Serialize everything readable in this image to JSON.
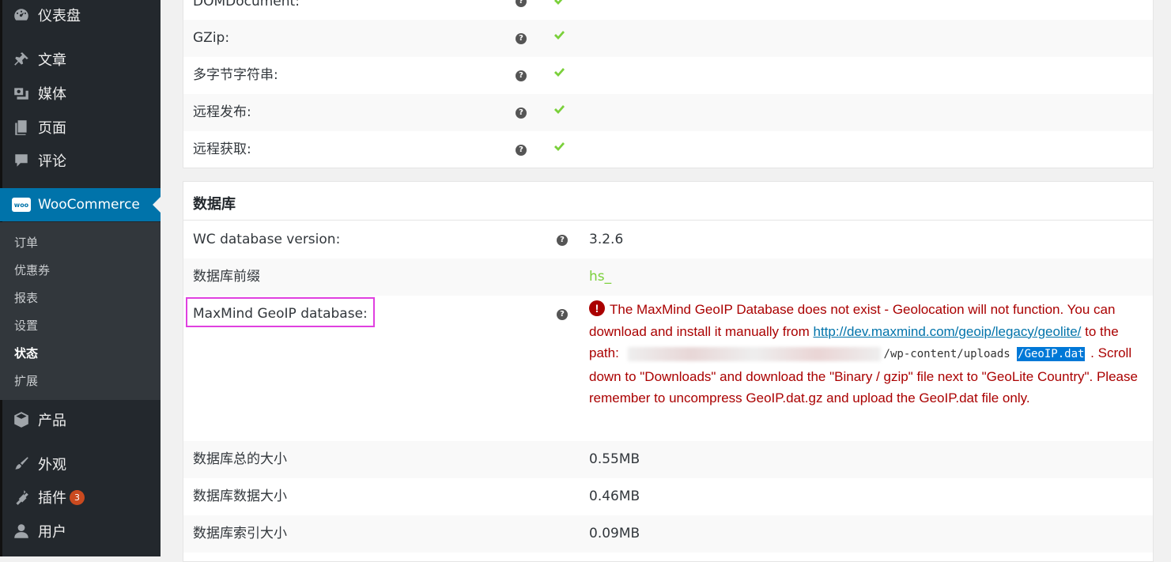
{
  "sidebar": {
    "items": [
      {
        "label": "仪表盘",
        "icon": "dashboard-icon"
      },
      {
        "label": "文章",
        "icon": "pin-icon"
      },
      {
        "label": "媒体",
        "icon": "media-icon"
      },
      {
        "label": "页面",
        "icon": "pages-icon"
      },
      {
        "label": "评论",
        "icon": "comment-icon"
      },
      {
        "label": "WooCommerce",
        "icon": "woocommerce-icon",
        "logo_text": "woo"
      },
      {
        "label": "产品",
        "icon": "product-box-icon"
      },
      {
        "label": "外观",
        "icon": "brush-icon"
      },
      {
        "label": "插件",
        "icon": "plugin-icon",
        "badge": "3"
      },
      {
        "label": "用户",
        "icon": "user-icon"
      }
    ],
    "woocommerce_submenu": [
      "订单",
      "优惠券",
      "报表",
      "设置",
      "状态",
      "扩展"
    ],
    "current_submenu": "状态"
  },
  "server_env": {
    "rows": [
      {
        "label": "DOMDocument:",
        "status": "ok"
      },
      {
        "label": "GZip:",
        "status": "ok"
      },
      {
        "label": "多字节字符串:",
        "status": "ok"
      },
      {
        "label": "远程发布:",
        "status": "ok"
      },
      {
        "label": "远程获取:",
        "status": "ok"
      }
    ]
  },
  "database": {
    "title": "数据库",
    "rows": [
      {
        "label": "WC database version:",
        "value": "3.2.6"
      },
      {
        "label": "数据库前缀",
        "value": "hs_"
      },
      {
        "label": "MaxMind GeoIP database:",
        "value": ""
      },
      {
        "label": "数据库总的大小",
        "value": "0.55MB"
      },
      {
        "label": "数据库数据大小",
        "value": "0.46MB"
      },
      {
        "label": "数据库索引大小",
        "value": "0.09MB"
      }
    ],
    "geoip_error": {
      "icon_glyph": "!",
      "text_1": "The MaxMind GeoIP Database does not exist - Geolocation will not function. You can download and install it manually from ",
      "link": "http://dev.maxmind.com/geoip/legacy/geolite/",
      "text_2": " to the path: ",
      "path_visible": "/wp-content/uploads",
      "path_selected": "/GeoIP.dat",
      "text_3": " . Scroll down to \"Downloads\" and download the \"Binary / gzip\" file next to \"GeoLite Country\". Please remember to uncompress GeoIP.dat.gz and upload the GeoIP.dat file only."
    }
  },
  "help_glyph": "?",
  "colors": {
    "sidebar_bg": "#23282d",
    "active_menu": "#0073aa",
    "check_green": "#7ad03a",
    "error_red": "#aa0000",
    "highlight": "#e040e0"
  }
}
